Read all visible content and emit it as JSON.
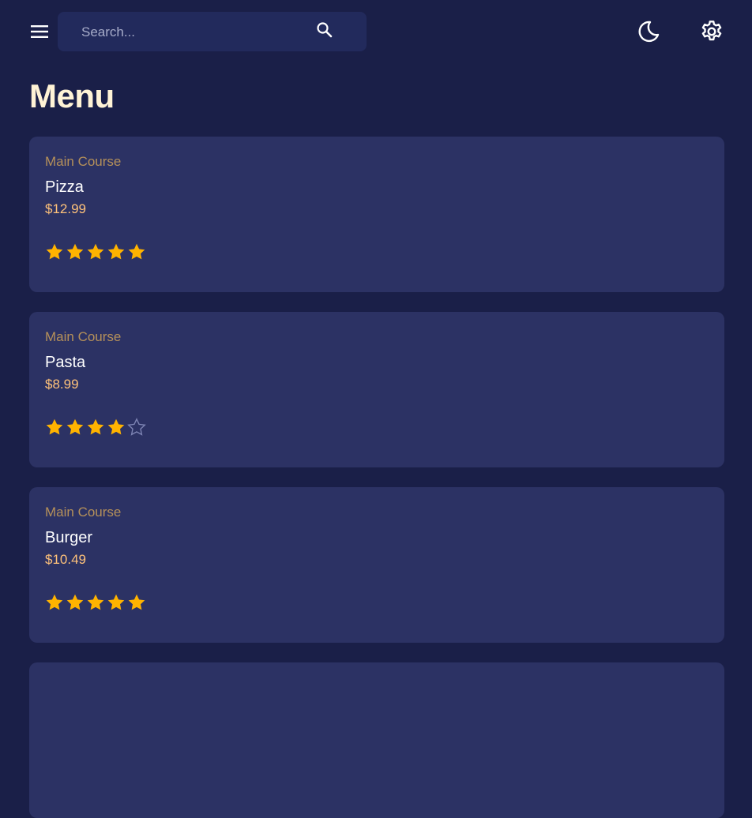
{
  "header": {
    "search_placeholder": "Search...",
    "icons": [
      "menu-icon",
      "search-icon",
      "moon-icon",
      "gear-icon"
    ]
  },
  "page": {
    "title": "Menu"
  },
  "colors": {
    "background": "#1a1f48",
    "card": "#2c3264",
    "category": "#b5905a",
    "price": "#ffc27a",
    "star_filled": "#ffb300",
    "star_empty": "#7d84b3",
    "title": "#fff3d6"
  },
  "menu_items": [
    {
      "category": "Main Course",
      "name": "Pizza",
      "price": "$12.99",
      "rating": 5
    },
    {
      "category": "Main Course",
      "name": "Pasta",
      "price": "$8.99",
      "rating": 4
    },
    {
      "category": "Main Course",
      "name": "Burger",
      "price": "$10.49",
      "rating": 5
    }
  ],
  "rating_max": 5
}
